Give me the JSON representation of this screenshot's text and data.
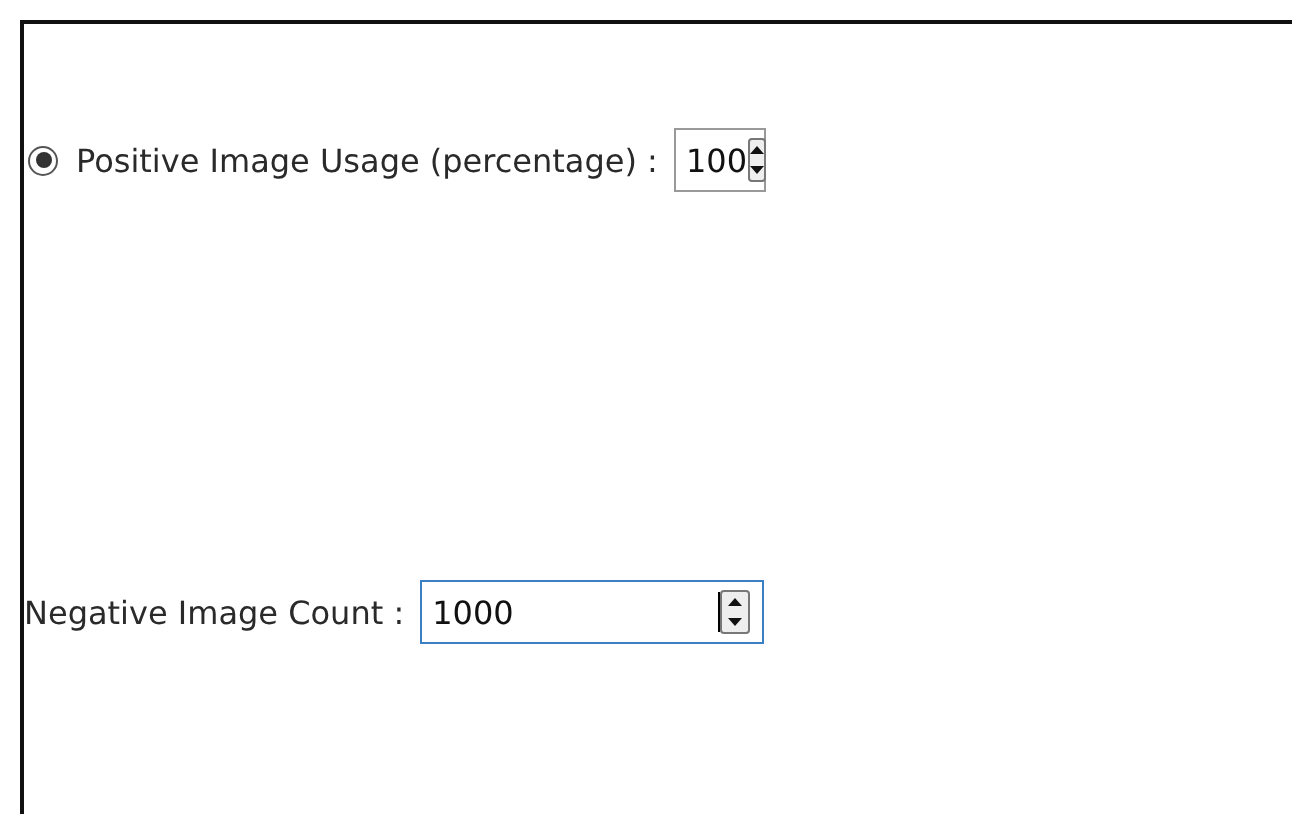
{
  "positive_usage": {
    "label": "Positive Image Usage (percentage) :",
    "selected": true,
    "value": "100",
    "focused": false
  },
  "negative_count": {
    "label": "Negative Image Count :",
    "value": "1000",
    "focused": true
  }
}
